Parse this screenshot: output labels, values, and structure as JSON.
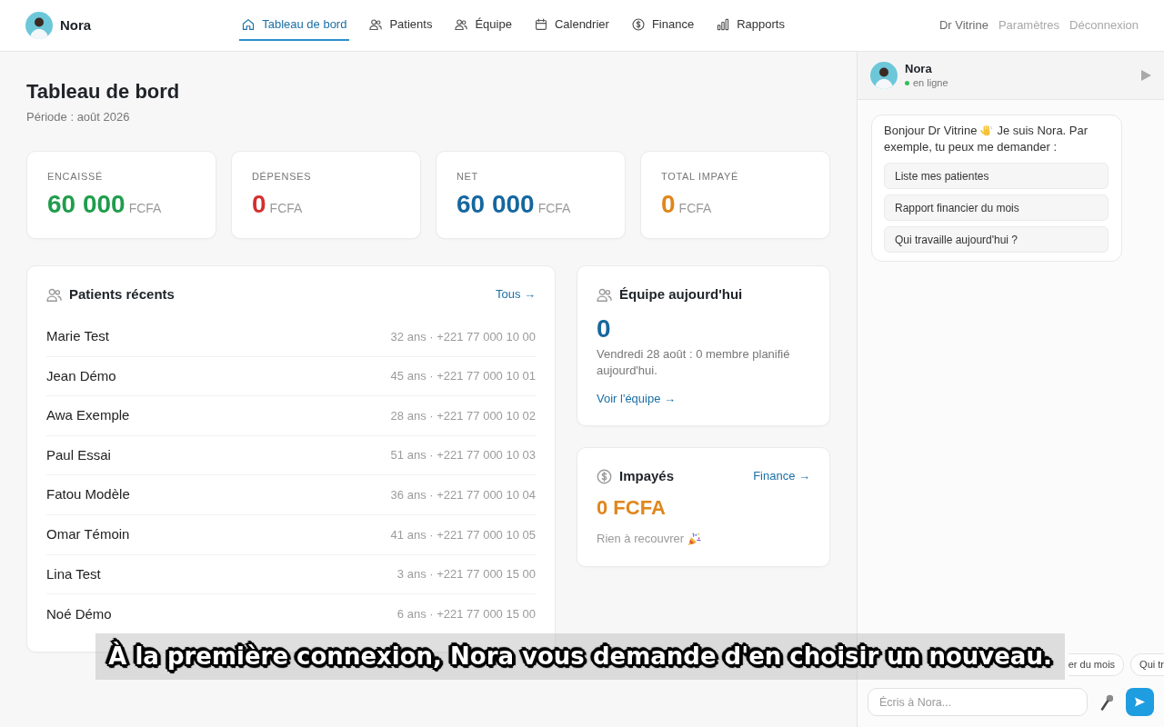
{
  "nav": {
    "brand": "Nora",
    "items": [
      {
        "label": "Tableau de bord",
        "selected": true
      },
      {
        "label": "Patients",
        "selected": false
      },
      {
        "label": "Équipe",
        "selected": false
      },
      {
        "label": "Calendrier",
        "selected": false
      },
      {
        "label": "Finance",
        "selected": false
      },
      {
        "label": "Rapports",
        "selected": false
      }
    ],
    "user": "Dr Vitrine",
    "links": [
      "Paramètres",
      "Déconnexion"
    ]
  },
  "page": {
    "title": "Tableau de bord",
    "period": "Période : août 2026"
  },
  "kpis": [
    {
      "label": "ENCAISSÉ",
      "value": "60 000",
      "unit": "FCFA",
      "color": "#1f9d4c"
    },
    {
      "label": "DÉPENSES",
      "value": "0",
      "unit": "FCFA",
      "color": "#d3302f"
    },
    {
      "label": "NET",
      "value": "60 000",
      "unit": "FCFA",
      "color": "#15679f"
    },
    {
      "label": "TOTAL IMPAYÉ",
      "value": "0",
      "unit": "FCFA",
      "color": "#e0861c"
    }
  ],
  "patients": {
    "title": "Patients récents",
    "link": "Tous →",
    "rows": [
      {
        "name": "Marie Test",
        "details": "32 ans · +221 77 000 10 00"
      },
      {
        "name": "Jean Démo",
        "details": "45 ans · +221 77 000 10 01"
      },
      {
        "name": "Awa Exemple",
        "details": "28 ans · +221 77 000 10 02"
      },
      {
        "name": "Paul Essai",
        "details": "51 ans · +221 77 000 10 03"
      },
      {
        "name": "Fatou Modèle",
        "details": "36 ans · +221 77 000 10 04"
      },
      {
        "name": "Omar Témoin",
        "details": "41 ans · +221 77 000 10 05"
      },
      {
        "name": "Lina Test",
        "details": "3 ans · +221 77 000 15 00"
      },
      {
        "name": "Noé Démo",
        "details": "6 ans · +221 77 000 15 00"
      }
    ]
  },
  "team": {
    "title": "Équipe aujourd'hui",
    "count": "0",
    "text": "Vendredi 28 août : 0 membre planifié aujourd'hui.",
    "link": "Voir l'équipe →"
  },
  "unpaid": {
    "title": "Impayés",
    "link": "Finance →",
    "amount": "0 FCFA",
    "note": "Rien à recouvrer"
  },
  "chat": {
    "name": "Nora",
    "status": "en ligne",
    "online": true,
    "greeting": [
      "Bonjour Dr Vitrine",
      "Je suis Nora. Par",
      "exemple, tu peux me demander :"
    ],
    "suggestions": [
      "Liste mes patientes",
      "Rapport financier du mois",
      "Qui travaille aujourd'hui ?"
    ],
    "chips": [
      "er du mois",
      "Qui tr"
    ],
    "input": {
      "placeholder": "Écris à Nora..."
    }
  },
  "subtitle": "À la première connexion, Nora vous demande d'en choisir un nouveau."
}
